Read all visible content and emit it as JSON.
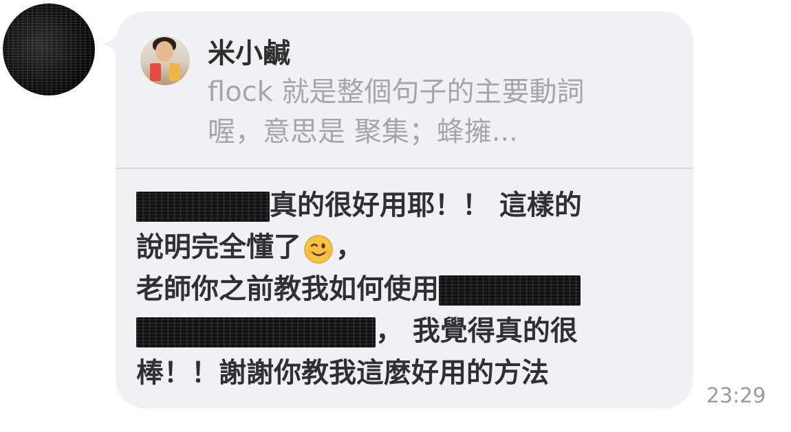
{
  "timestamp": "23:29",
  "reply_quote": {
    "author_name": "米小鹹",
    "preview_lines": [
      "flock 就是整個句子的主要動詞",
      "喔，意思是 聚集；蜂擁..."
    ]
  },
  "message": {
    "line1_text": "真的很好用耶！！ 這樣的",
    "line2_text": "說明完全懂了",
    "line2_emoji": "winking-face",
    "line2_suffix": "，",
    "line3_text": "老師你之前教我如何使用",
    "line4_text": "， 我覺得真的很",
    "line5_text": "棒！！謝謝你教我這麼好用的方法"
  },
  "colors": {
    "bubble_background": "#f0f1f4",
    "message_text": "#2f3033",
    "preview_text": "#a4a6aa",
    "timestamp_text": "#9a9ca0"
  }
}
